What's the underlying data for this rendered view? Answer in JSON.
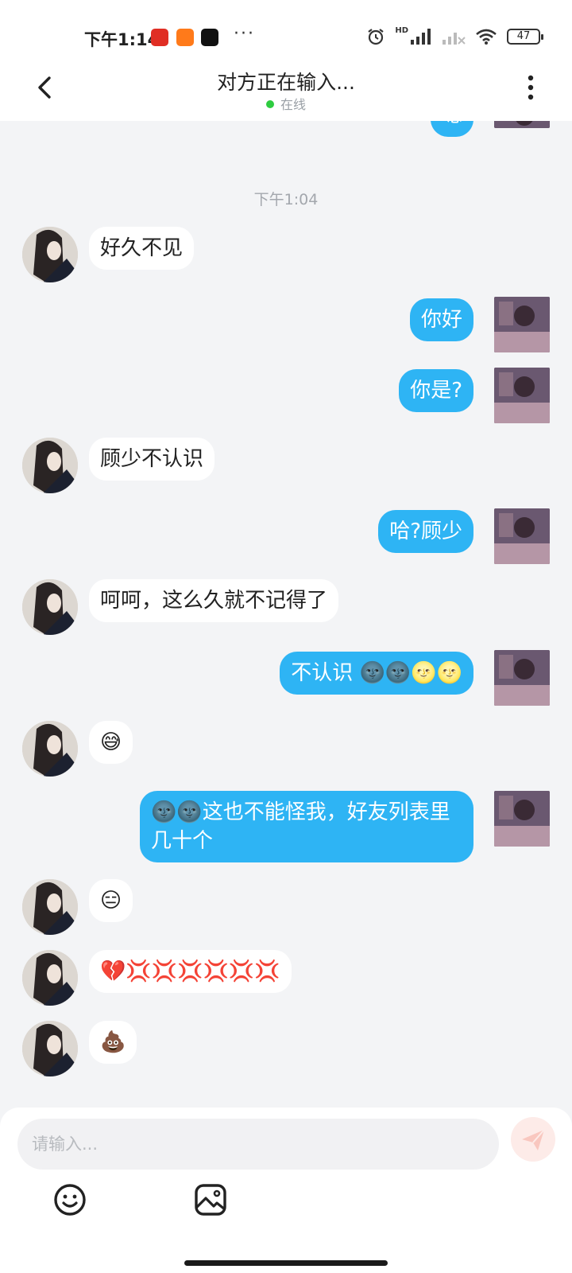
{
  "status_bar": {
    "time": "下午1:14",
    "app_icons": [
      "pinduoduo-icon",
      "taobao-icon",
      "tiktok-icon"
    ],
    "more": "···",
    "network_label": "HD",
    "battery": "47"
  },
  "header": {
    "title": "对方正在输入...",
    "status": "在线"
  },
  "chat": {
    "timestamp": "下午1:04",
    "partial_top_text": "嗯",
    "messages": [
      {
        "side": "in",
        "text": "好久不见"
      },
      {
        "side": "out",
        "text": "你好"
      },
      {
        "side": "out",
        "text": "你是?"
      },
      {
        "side": "in",
        "text": "顾少不认识"
      },
      {
        "side": "out",
        "text": "哈?顾少"
      },
      {
        "side": "in",
        "text": "呵呵，这么久就不记得了"
      },
      {
        "side": "out",
        "text": "不认识 🌚🌚🌝🌝"
      },
      {
        "side": "in",
        "text": "😅"
      },
      {
        "side": "out",
        "text": "🌚🌚这也不能怪我，好友列表里几十个"
      },
      {
        "side": "in",
        "text": "😑"
      },
      {
        "side": "in",
        "text": "💔💢💢💢💢💢💢"
      },
      {
        "side": "in",
        "text": "💩"
      }
    ]
  },
  "composer": {
    "placeholder": "请输入..."
  },
  "colors": {
    "outgoing_bubble": "#2eb4f4",
    "incoming_bubble": "#ffffff",
    "online": "#2ecc40"
  }
}
